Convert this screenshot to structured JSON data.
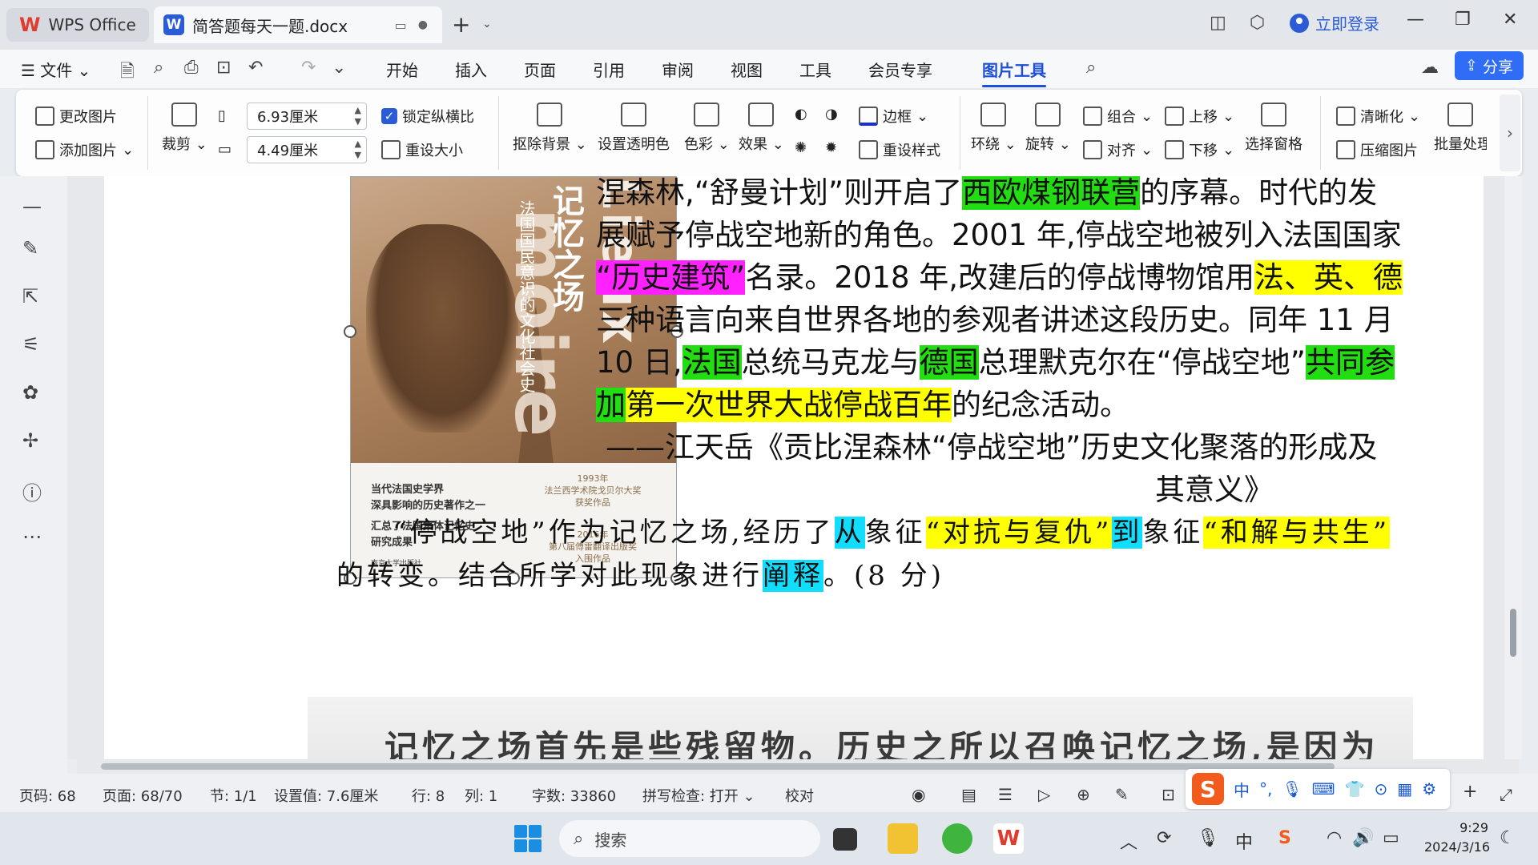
{
  "titlebar": {
    "home_tab": "WPS Office",
    "doc_tab": "简答题每天一题.docx",
    "login": "立即登录"
  },
  "menubar": {
    "file": "文件",
    "tabs": [
      "开始",
      "插入",
      "页面",
      "引用",
      "审阅",
      "视图",
      "工具",
      "会员专享",
      "图片工具"
    ],
    "active_tab": "图片工具",
    "share": "分享"
  },
  "ribbon": {
    "change_image": "更改图片",
    "add_image": "添加图片",
    "crop": "裁剪",
    "width_value": "6.93厘米",
    "height_value": "4.49厘米",
    "lock_ratio": "锁定纵横比",
    "reset_size": "重设大小",
    "remove_bg": "抠除背景",
    "set_transparent": "设置透明色",
    "color": "色彩",
    "effects": "效果",
    "border": "边框",
    "reset_style": "重设样式",
    "wrap": "环绕",
    "rotate": "旋转",
    "group": "组合",
    "align": "对齐",
    "bring_forward": "上移",
    "send_backward": "下移",
    "selection_pane": "选择窗格",
    "sharpen": "清晰化",
    "compress": "压缩图片",
    "batch": "批量处理"
  },
  "book": {
    "title_cn": "记忆之场",
    "subtitle": "法国国民意识的文化社会史",
    "latin1": "Lieux",
    "latin2": "moire",
    "blurb": [
      "当代法国史学界",
      "深具影响的历史著作之一",
      "汇总了法国集体记忆史",
      "研究成果"
    ],
    "award1": [
      "1993年",
      "法兰西学术院戈贝尔大奖",
      "获奖作品"
    ],
    "award2": [
      "2016年",
      "第八届傅雷翻译出版奖",
      "入围作品"
    ],
    "publisher": "南京大学出版社"
  },
  "document": {
    "l1_a": "涅森林,“舒曼计划”则开启了",
    "l1_b": "西欧煤钢联营",
    "l1_c": "的序幕。时代的发",
    "l2": "展赋予停战空地新的角色。2001 年,停战空地被列入法国国家",
    "l3_a": "“历史建筑”",
    "l3_b": "名录。2018 年,改建后的停战博物馆用",
    "l3_c": "法、英、德",
    "l4": "三种语言向来自世界各地的参观者讲述这段历史。同年 11 月",
    "l5_a": "10 日,",
    "l5_b": "法国",
    "l5_c": "总统马克龙与",
    "l5_d": "德国",
    "l5_e": "总理默克尔在“停战空地”",
    "l5_f": "共同参",
    "l6_a": "加",
    "l6_b": "第一次世界大战停战百年",
    "l6_c": "的纪念活动。",
    "l7": "——江天岳《贡比涅森林“停战空地”历史文化聚落的形成及",
    "l8": "其意义》",
    "q1_a": "“停战空地”作为记忆之场,经历了",
    "q1_b": "从",
    "q1_c": "象征",
    "q1_d": "“对抗与复仇”",
    "q1_e": "到",
    "q1_f": "象征",
    "q1_g": "“和解与共生”",
    "q2_a": "的转变。结合所学对此现象进行",
    "q2_b": "阐释",
    "q2_c": "。(8 分)",
    "scan": "记忆之场首先是些残留物。历史之所以召唤记忆之场,是因为"
  },
  "statusbar": {
    "page_code": "页码: 68",
    "page": "页面: 68/70",
    "section": "节: 1/1",
    "setting": "设置值: 7.6厘米",
    "row": "行: 8",
    "col": "列: 1",
    "words": "字数: 33860",
    "spell": "拼写检查: 打开",
    "proof": "校对"
  },
  "taskbar": {
    "search": "搜索",
    "time": "9:29",
    "date": "2024/3/16"
  },
  "colors": {
    "accent": "#1c4fd6",
    "highlight_green": "#22dd11",
    "highlight_yellow": "#ffff00",
    "highlight_magenta": "#ff22ff",
    "highlight_cyan": "#11ddff"
  }
}
